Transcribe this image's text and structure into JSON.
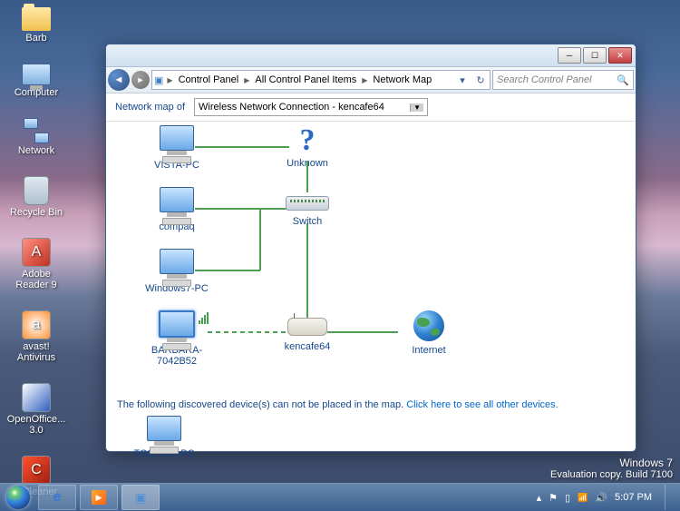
{
  "desktop": {
    "icons": [
      "Barb",
      "Computer",
      "Network",
      "Recycle Bin",
      "Adobe Reader 9",
      "avast! Antivirus",
      "OpenOffice... 3.0",
      "CCleaner"
    ]
  },
  "window": {
    "breadcrumbs": [
      "Control Panel",
      "All Control Panel Items",
      "Network Map"
    ],
    "search_placeholder": "Search Control Panel",
    "map_label": "Network map of",
    "dropdown_value": "Wireless Network Connection - kencafe64",
    "nodes": {
      "n1": "VISTA-PC",
      "n2": "compaq",
      "n3": "Windows7-PC",
      "n4": "BARBARA-7042B52",
      "unk": "Unknown",
      "sw": "Switch",
      "rt": "kencafe64",
      "net": "Internet"
    },
    "footer_msg": "The following discovered device(s) can not be placed in the map. ",
    "footer_link": "Click here to see all other devices.",
    "unplaced": "TOSHIBA-PC"
  },
  "watermark": {
    "title": "Windows 7",
    "sub": "Evaluation copy. Build 7100"
  },
  "taskbar": {
    "time": "5:07 PM"
  }
}
